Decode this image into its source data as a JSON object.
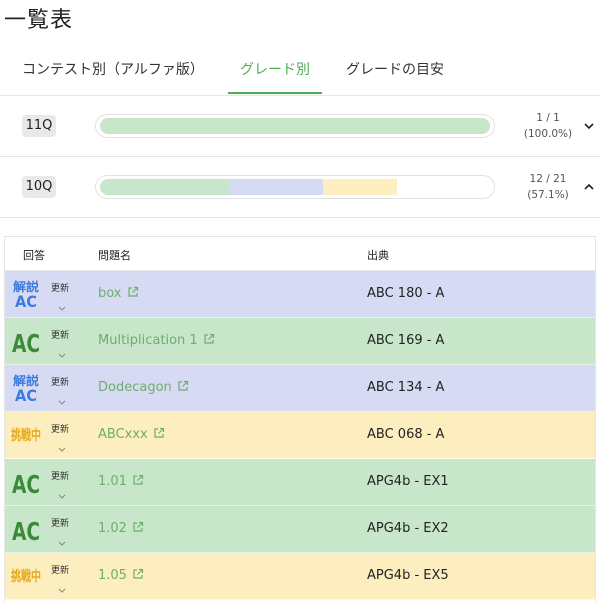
{
  "page": {
    "title": "一覧表"
  },
  "tabs": [
    {
      "label": "コンテスト別（アルファ版）",
      "active": false
    },
    {
      "label": "グレード別",
      "active": true
    },
    {
      "label": "グレードの目安",
      "active": false
    }
  ],
  "colors": {
    "accent": "#4caf50",
    "ac": "#c8e6c9",
    "editorial_ac": "#d6daf2",
    "trying": "#fdeec0",
    "ac_text": "#3a8a3a",
    "editorial_text": "#3d7be0",
    "trying_text": "#e6a817"
  },
  "grades": [
    {
      "label": "11Q",
      "count": "1 / 1",
      "percent": "(100.0%)",
      "segments": [
        {
          "status": "ac",
          "fraction": 1.0
        }
      ],
      "chevron": "chevron-down-icon"
    },
    {
      "label": "10Q",
      "count": "12 / 21",
      "percent": "(57.1%)",
      "segments": [
        {
          "status": "ac",
          "fraction": 0.333
        },
        {
          "status": "editorial_ac",
          "fraction": 0.238
        },
        {
          "status": "trying",
          "fraction": 0.19
        }
      ],
      "chevron": "chevron-up-icon"
    }
  ],
  "table": {
    "headers": [
      "回答",
      "問題名",
      "出典"
    ],
    "update_label": "更新",
    "rows": [
      {
        "status": "editorial_ac",
        "badge_top": "解説",
        "badge_bottom": "AC",
        "name": "box",
        "source": "ABC 180 - A"
      },
      {
        "status": "ac",
        "badge_top": "",
        "badge_bottom": "AC",
        "name": "Multiplication 1",
        "source": "ABC 169 - A"
      },
      {
        "status": "editorial_ac",
        "badge_top": "解説",
        "badge_bottom": "AC",
        "name": "Dodecagon",
        "source": "ABC 134 - A"
      },
      {
        "status": "trying",
        "badge_top": "挑戦中",
        "badge_bottom": "",
        "name": "ABCxxx",
        "source": "ABC 068 - A"
      },
      {
        "status": "ac",
        "badge_top": "",
        "badge_bottom": "AC",
        "name": "1.01",
        "source": "APG4b - EX1"
      },
      {
        "status": "ac",
        "badge_top": "",
        "badge_bottom": "AC",
        "name": "1.02",
        "source": "APG4b - EX2"
      },
      {
        "status": "trying",
        "badge_top": "挑戦中",
        "badge_bottom": "",
        "name": "1.05",
        "source": "APG4b - EX5"
      }
    ]
  }
}
